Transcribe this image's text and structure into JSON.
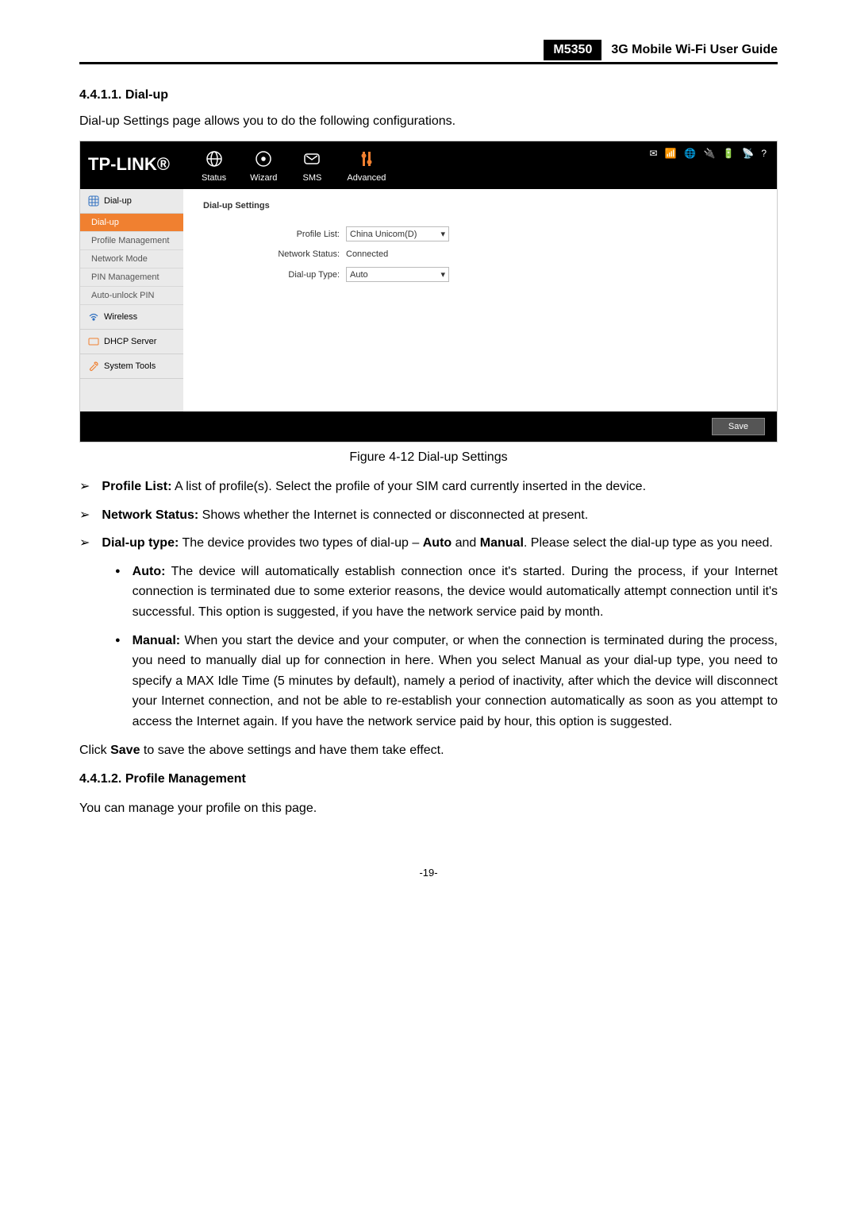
{
  "header": {
    "model": "M5350",
    "guide_title": "3G Mobile Wi-Fi User Guide"
  },
  "section1": {
    "number_title": "4.4.1.1.  Dial-up",
    "intro": "Dial-up Settings page allows you to do the following configurations."
  },
  "screenshot": {
    "logo": "TP-LINK®",
    "nav": {
      "status": "Status",
      "wizard": "Wizard",
      "sms": "SMS",
      "advanced": "Advanced"
    },
    "sidebar": {
      "dialup_group": "Dial-up",
      "dialup": "Dial-up",
      "profile_mgmt": "Profile Management",
      "network_mode": "Network Mode",
      "pin_mgmt": "PIN Management",
      "auto_unlock": "Auto-unlock PIN",
      "wireless": "Wireless",
      "dhcp": "DHCP Server",
      "system_tools": "System Tools"
    },
    "main": {
      "title": "Dial-up Settings",
      "profile_list_label": "Profile List:",
      "profile_list_value": "China Unicom(D)",
      "network_status_label": "Network Status:",
      "network_status_value": "Connected",
      "dialup_type_label": "Dial-up Type:",
      "dialup_type_value": "Auto"
    },
    "save_btn": "Save"
  },
  "figure_caption": "Figure 4-12 Dial-up Settings",
  "bullets": {
    "profile_list": {
      "label": "Profile List:",
      "text": " A list of profile(s). Select the profile of your SIM card currently inserted in the device."
    },
    "network_status": {
      "label": "Network Status:",
      "text": " Shows whether the Internet is connected or disconnected at present."
    },
    "dialup_type": {
      "label": "Dial-up type:",
      "text_a": " The device provides two types of dial-up – ",
      "auto_word": "Auto",
      "text_b": " and ",
      "manual_word": "Manual",
      "text_c": ". Please select the dial-up type as you need."
    },
    "auto": {
      "label": "Auto:",
      "text": " The device will automatically establish connection once it's started. During the process, if your Internet connection is terminated due to some exterior reasons, the device would automatically attempt connection until it's successful. This option is suggested, if you have the network service paid by month."
    },
    "manual": {
      "label": "Manual:",
      "text": " When you start the device and your computer, or when the connection is terminated during the process, you need to manually dial up for connection in here. When you select Manual as your dial-up type, you need to specify a MAX Idle Time (5 minutes by default), namely a period of inactivity, after which the device will disconnect your Internet connection, and not be able to re-establish your connection automatically as soon as you attempt to access the Internet again. If you have the network service paid by hour, this option is suggested."
    }
  },
  "save_para_a": "Click ",
  "save_para_b": "Save",
  "save_para_c": " to save the above settings and have them take effect.",
  "section2": {
    "number_title": "4.4.1.2.  Profile Management",
    "intro": "You can manage your profile on this page."
  },
  "page_number": "-19-"
}
